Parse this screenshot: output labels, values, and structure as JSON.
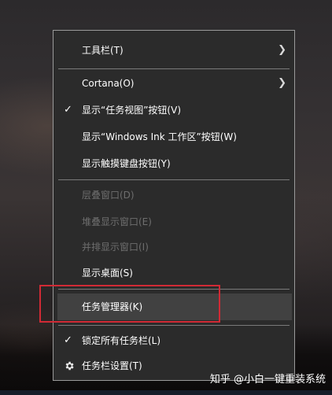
{
  "menu": {
    "items": [
      {
        "label": "工具栏(T)",
        "submenu": true,
        "disabled": false
      },
      {
        "label": "Cortana(O)",
        "submenu": true,
        "disabled": false
      },
      {
        "label": "显示“任务视图”按钮(V)",
        "checked": true,
        "disabled": false
      },
      {
        "label": "显示“Windows Ink 工作区”按钮(W)",
        "disabled": false
      },
      {
        "label": "显示触摸键盘按钮(Y)",
        "disabled": false
      },
      {
        "label": "层叠窗口(D)",
        "disabled": true
      },
      {
        "label": "堆叠显示窗口(E)",
        "disabled": true
      },
      {
        "label": "并排显示窗口(I)",
        "disabled": true
      },
      {
        "label": "显示桌面(S)",
        "disabled": false
      },
      {
        "label": "任务管理器(K)",
        "highlighted": true,
        "disabled": false
      },
      {
        "label": "锁定所有任务栏(L)",
        "checked": true,
        "disabled": false
      },
      {
        "label": "任务栏设置(T)",
        "icon": "gear-icon",
        "disabled": false
      }
    ],
    "colors": {
      "background": "#2b2b2b",
      "border": "#9a9a9a",
      "highlight": "#414141",
      "disabled_text": "#6e6e6e",
      "annotation_box": "#d12a35"
    }
  },
  "watermark": "知乎 @小白一键重装系统"
}
